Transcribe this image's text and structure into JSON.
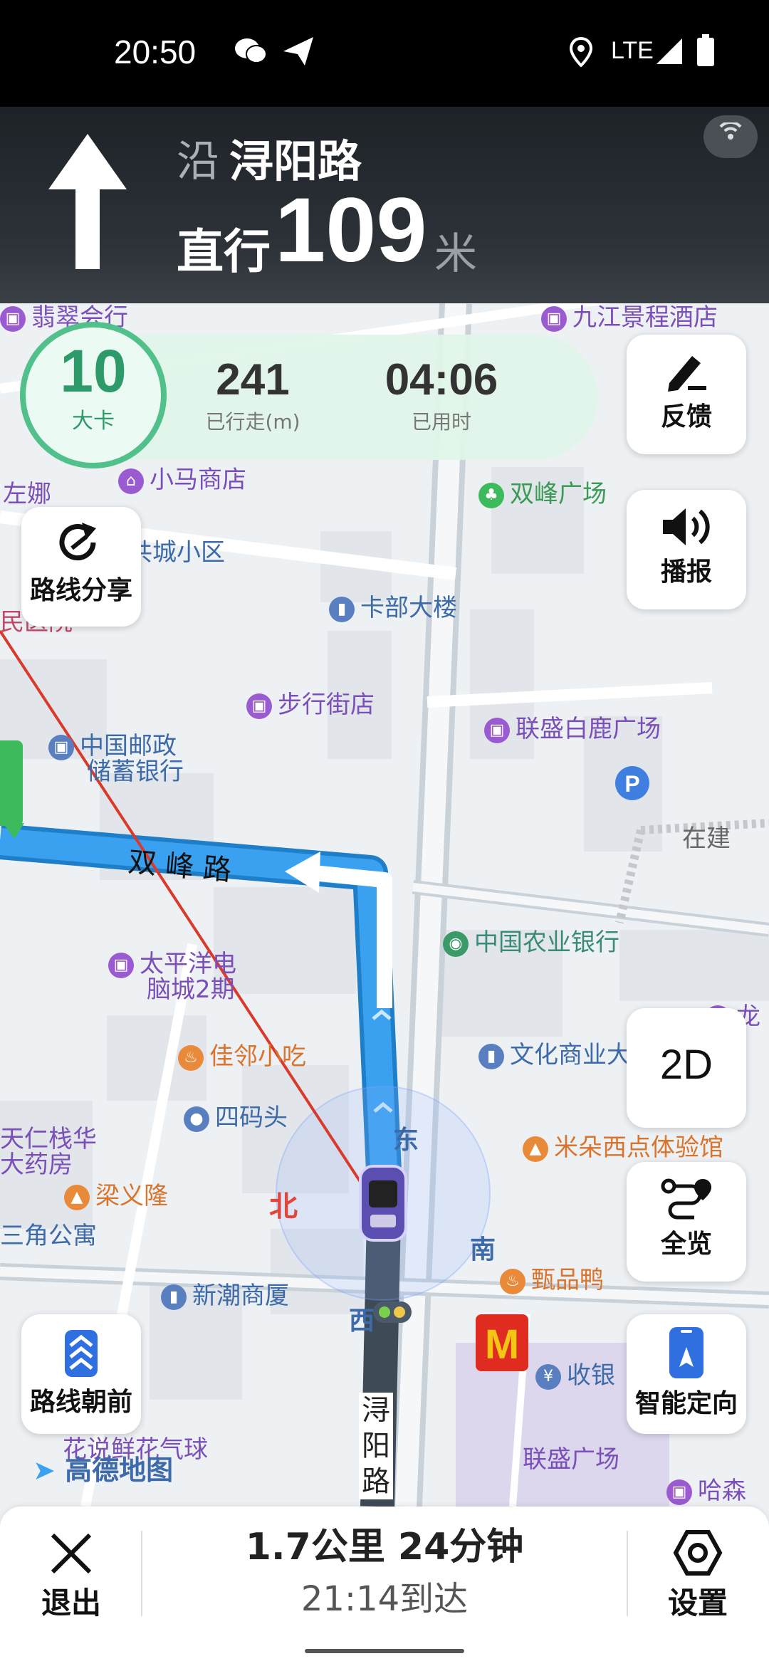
{
  "status_bar": {
    "time": "20:50",
    "network": "LTE"
  },
  "guidance": {
    "prefix": "沿",
    "road": "浔阳路",
    "action": "直行",
    "distance": "109",
    "unit": "米"
  },
  "stats": {
    "speed": {
      "value": "10",
      "label": "大卡"
    },
    "traveled": {
      "value": "241",
      "label": "已行走(m)"
    },
    "elapsed": {
      "value": "04:06",
      "label": "已用时"
    }
  },
  "buttons": {
    "feedback": "反馈",
    "broadcast": "播报",
    "share_route": "路线分享",
    "view_mode": "2D",
    "overview": "全览",
    "route_heading": "路线朝前",
    "smart_orientation": "智能定向"
  },
  "map": {
    "pois": {
      "jiujiang_hotel": "九江景程酒店",
      "feicui": "翡翠会行",
      "xiaoma": "小马商店",
      "shuangfeng_square": "双峰广场",
      "zuona": "左娜",
      "gongcheng": "共城小区",
      "minyi": "民医院",
      "kabu": "卡部大楼",
      "buxing": "步行街店",
      "youzheng_1": "中国邮政",
      "youzheng_2": "储蓄银行",
      "liansheng_bailu": "联盛白鹿广场",
      "zaijian": "在建",
      "nongye": "中国农业银行",
      "taipingyang_1": "太平洋电",
      "taipingyang_2": "脑城2期",
      "long": "龙",
      "jialin": "佳邻小吃",
      "wenhua": "文化商业大厦",
      "simatou": "四码头",
      "miduo": "米朵西点体验馆",
      "tianren_1": "天仁栈华",
      "tianren_2": "大药房",
      "liangyilong": "梁义隆",
      "sanjiao": "三角公寓",
      "zhenpinya": "甄品鸭",
      "xinchao": "新潮商厦",
      "shouyin": "收银",
      "huashuo": "花说鲜花气球",
      "liansheng": "联盛广场",
      "hasen": "哈森"
    },
    "roads": {
      "shuangfeng_road": "双 峰 路",
      "xunyang_road": "浔\n阳\n路"
    },
    "compass": {
      "north": "北",
      "east": "东",
      "south": "南",
      "west": "西"
    },
    "brand": "高德地图"
  },
  "bottom_bar": {
    "exit": "退出",
    "summary": "1.7公里  24分钟",
    "eta": "21:14到达",
    "settings": "设置"
  },
  "colors": {
    "route": "#3aa0f0",
    "accent_green": "#52c08a",
    "header_bg": "#252a30"
  }
}
